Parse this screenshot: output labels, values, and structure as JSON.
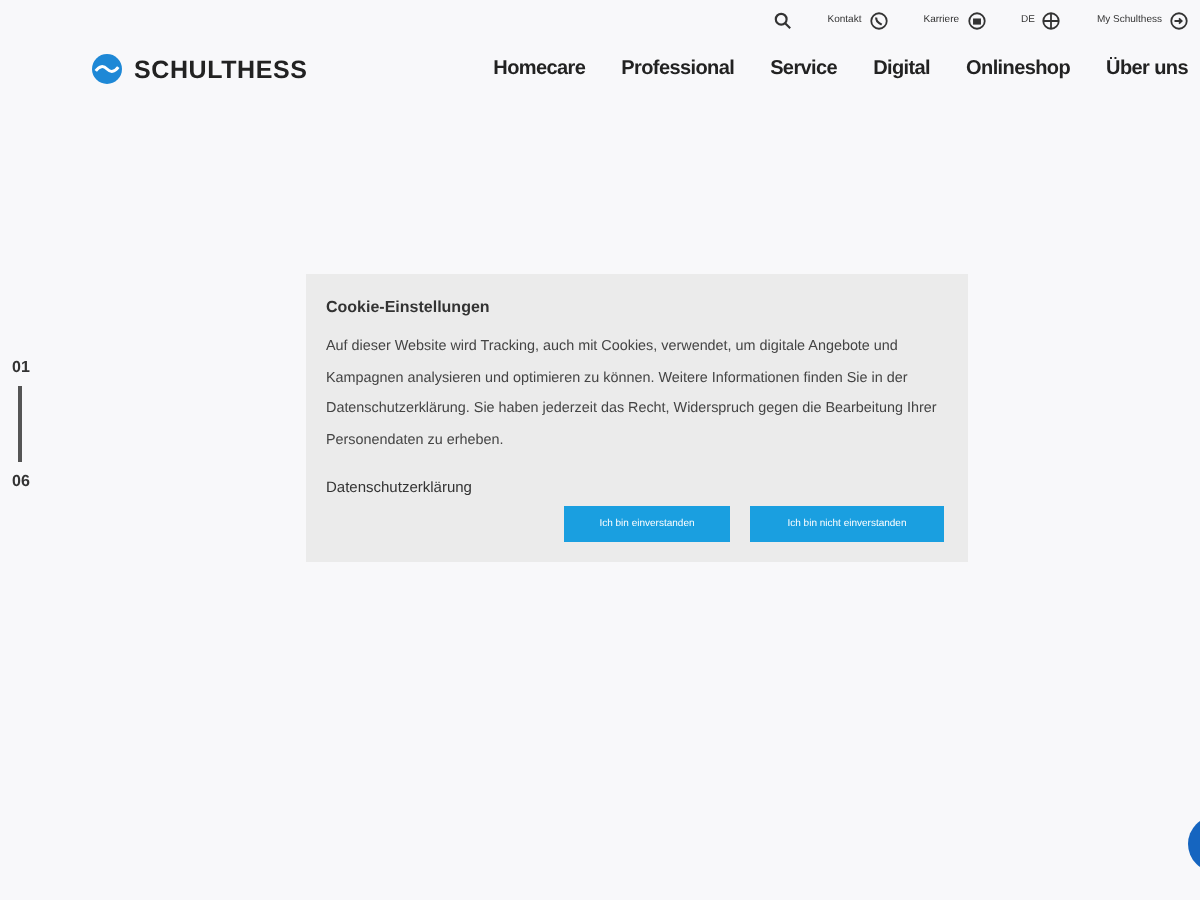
{
  "utility_bar": {
    "items": [
      {
        "kind": "search"
      },
      {
        "label": "Kontakt",
        "kind": "phone"
      },
      {
        "label": "Karriere",
        "kind": "briefcase"
      },
      {
        "label": "DE",
        "kind": "globe"
      },
      {
        "label": "My Schulthess",
        "kind": "login"
      }
    ]
  },
  "header": {
    "logo": "SCHULTHESS",
    "nav": [
      "Homecare",
      "Professional",
      "Service",
      "Digital",
      "Onlineshop",
      "Über uns"
    ]
  },
  "slide_indicator": {
    "current": "01",
    "total": "06"
  },
  "cookie_dialog": {
    "title": "Cookie-Einstellungen",
    "text": "Auf dieser Website wird Tracking, auch mit Cookies, verwendet, um digitale Angebote und Kampagnen analysieren und optimieren zu können. Weitere Informationen finden Sie in der Datenschutzerklärung. Sie haben jederzeit das Recht, Widerspruch gegen die Bearbeitung Ihrer Personendaten zu erheben.",
    "link": "Datenschutzerklärung",
    "buttons": [
      "Ich bin einverstanden",
      "Ich bin nicht einverstanden"
    ]
  }
}
